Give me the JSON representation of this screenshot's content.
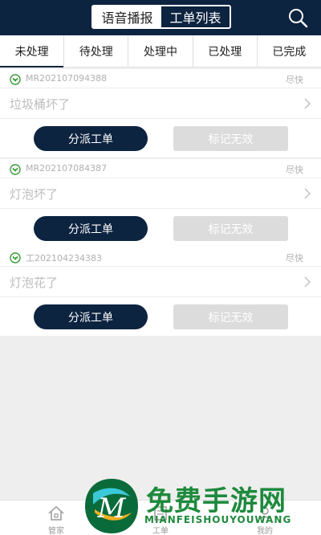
{
  "header": {
    "segments": [
      "语音播报",
      "工单列表"
    ],
    "active_segment": 0,
    "search_icon": "search-icon"
  },
  "tabs": [
    {
      "label": "未处理",
      "active": true
    },
    {
      "label": "待处理",
      "active": false
    },
    {
      "label": "处理中",
      "active": false
    },
    {
      "label": "已处理",
      "active": false
    },
    {
      "label": "已完成",
      "active": false
    }
  ],
  "orders": [
    {
      "id": "MR202107094388",
      "priority": "尽快",
      "title": "垃圾桶坏了",
      "dispatch_label": "分派工单",
      "invalid_label": "标记无效"
    },
    {
      "id": "MR202107084387",
      "priority": "尽快",
      "title": "灯泡坏了",
      "dispatch_label": "分派工单",
      "invalid_label": "标记无效"
    },
    {
      "id": "工202104234383",
      "priority": "尽快",
      "title": "灯泡花了",
      "dispatch_label": "分派工单",
      "invalid_label": "标记无效"
    }
  ],
  "bottom_nav": [
    {
      "label": "管家",
      "icon": "home-icon"
    },
    {
      "label": "工单",
      "icon": "ticket-icon"
    },
    {
      "label": "我的",
      "icon": "user-icon"
    }
  ],
  "watermark": {
    "logo_letter": "M",
    "text": "免费手游网",
    "subtext": "MIANFEISHOUYOUWANG"
  },
  "colors": {
    "primary": "#0d2440",
    "disabled_button": "#dcdcdc",
    "icon_green": "#3a9a3a",
    "watermark_green": "#1e8a3d"
  }
}
